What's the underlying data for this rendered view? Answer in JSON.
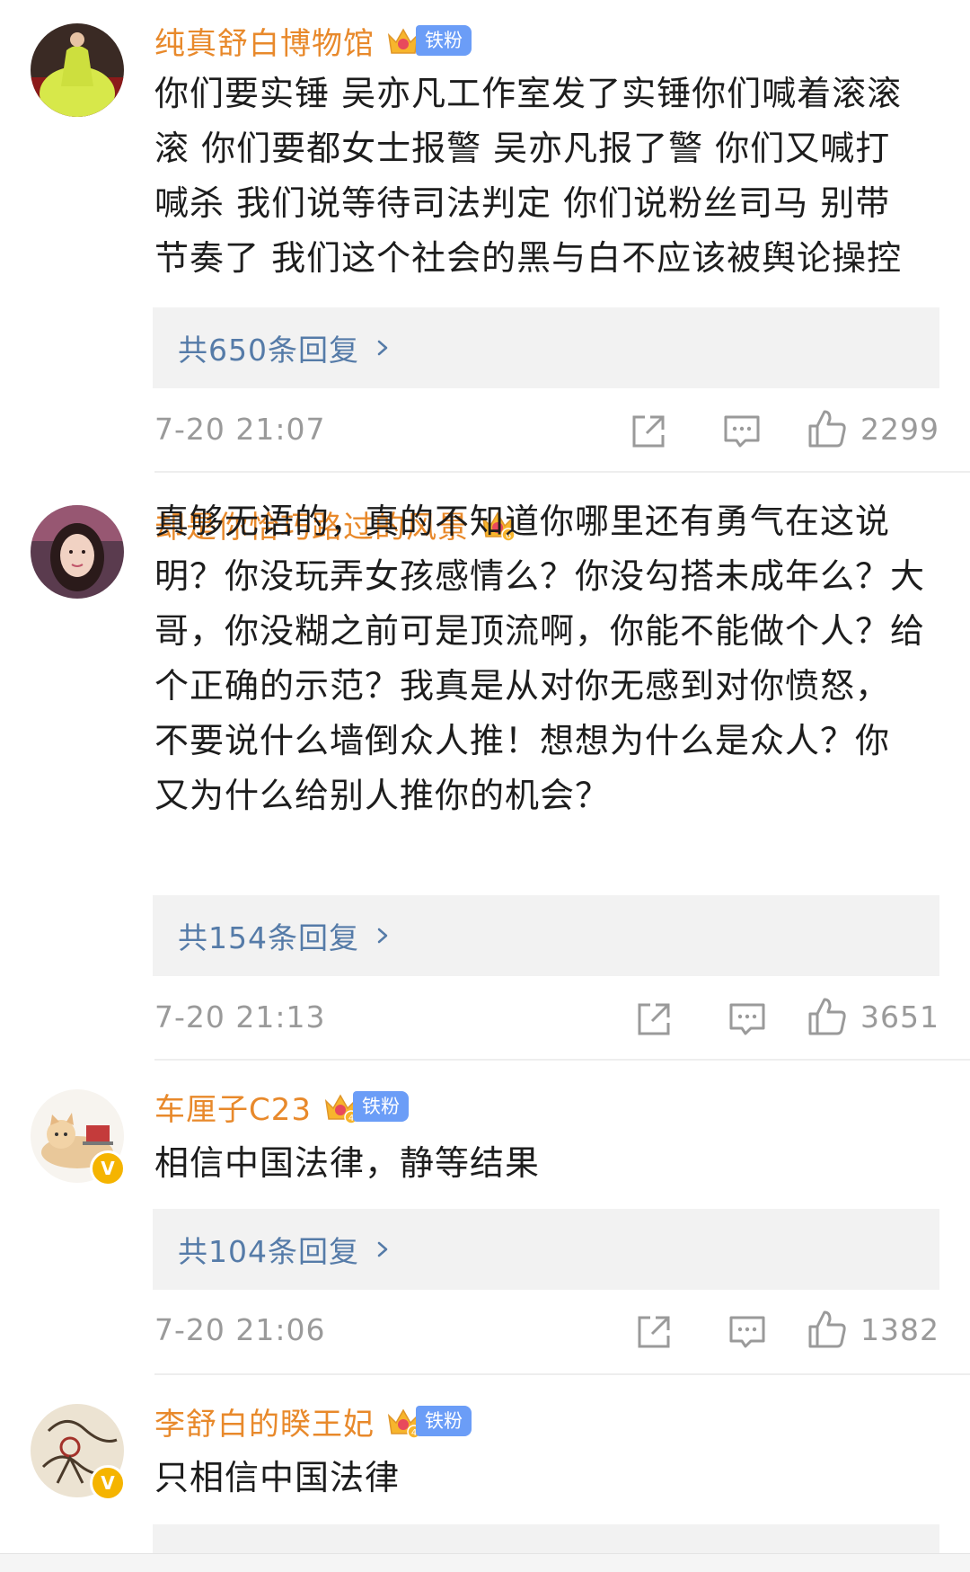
{
  "comments": [
    {
      "username": "纯真舒白博物馆",
      "fan_badge": "铁粉",
      "crown_level": "",
      "text_lines": [
        "你们要实锤 吴亦凡工作室发了实锤你们喊着滚滚",
        "滚 你们要都女士报警 吴亦凡报了警 你们又喊打",
        "喊杀 我们说等待司法判定 你们说粉丝司马 别带",
        "节奏了 我们这个社会的黑与白不应该被舆论操控"
      ],
      "replies_label": "共650条回复",
      "timestamp": "7-20 21:07",
      "likes": "2299",
      "avatar_icon": "avatar-photo-green-dress",
      "verified": false
    },
    {
      "username": "却是你恰巧路过的风景",
      "fan_badge": "",
      "crown_level": "6",
      "text_lines": [
        "真够无语的，真的不知道你哪里还有勇气在这说",
        "明？你没玩弄女孩感情么？你没勾搭未成年么？大",
        "哥，你没糊之前可是顶流啊，你能不能做个人？给",
        "个正确的示范？我真是从对你无感到对你愤怒，",
        "不要说什么墙倒众人推！想想为什么是众人？你",
        "又为什么给别人推你的机会？"
      ],
      "replies_label": "共154条回复",
      "timestamp": "7-20 21:13",
      "likes": "3651",
      "avatar_icon": "avatar-photo-girl",
      "verified": false
    },
    {
      "username": "车厘子C23",
      "fan_badge": "铁粉",
      "crown_level": "4",
      "text_lines": [
        "相信中国法律，静等结果"
      ],
      "replies_label": "共104条回复",
      "timestamp": "7-20 21:06",
      "likes": "1382",
      "avatar_icon": "avatar-cat-laptop",
      "verified": true
    },
    {
      "username": "李舒白的睽王妃",
      "fan_badge": "铁粉",
      "crown_level": "4",
      "text_lines": [
        "只相信中国法律"
      ],
      "replies_label": "",
      "timestamp": "",
      "likes": "",
      "avatar_icon": "avatar-ink-illustration",
      "verified": true
    }
  ],
  "verified_mark": "V",
  "icons": {
    "share": "share-icon",
    "comment": "comment-icon",
    "like": "like-icon",
    "chevron": "chevron-right-icon",
    "crown": "crown-icon"
  },
  "colors": {
    "username": "#e8892b",
    "replies_link": "#557ba8",
    "meta_gray": "#9a9a9a",
    "fan_badge": "#6b9df7",
    "verified": "#f5b400"
  }
}
